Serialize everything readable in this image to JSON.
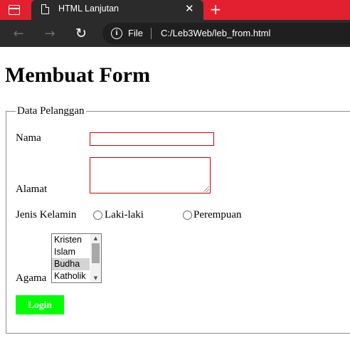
{
  "browser": {
    "tab_title": "HTML Lanjutan",
    "tab_close": "✕",
    "new_tab": "+",
    "back": "←",
    "forward": "→",
    "reload": "↻",
    "info": "i",
    "file_label": "File",
    "url": "C:/Leb3Web/leb_from.html"
  },
  "page": {
    "heading": "Membuat Form",
    "legend": "Data Pelanggan",
    "labels": {
      "nama": "Nama",
      "alamat": "Alamat",
      "jenis_kelamin": "Jenis Kelamin",
      "agama": "Agama"
    },
    "nama_value": "",
    "alamat_value": "",
    "gender_options": [
      "Laki-laki",
      "Perempuan"
    ],
    "agama_options": [
      "Kristen",
      "Islam",
      "Budha",
      "Katholik"
    ],
    "agama_selected": "Budha",
    "login_label": "Login"
  },
  "colors": {
    "tabbar": "#e3202f",
    "chrome_dark": "#2b2b2b",
    "input_border": "#cc0000",
    "login_button": "#00ff00"
  },
  "icons": [
    "tab-actions-icon",
    "page-icon",
    "close-icon",
    "plus-icon",
    "back-arrow-icon",
    "forward-arrow-icon",
    "reload-icon",
    "info-icon",
    "resize-grip-icon",
    "scroll-up-icon",
    "scroll-down-icon"
  ]
}
